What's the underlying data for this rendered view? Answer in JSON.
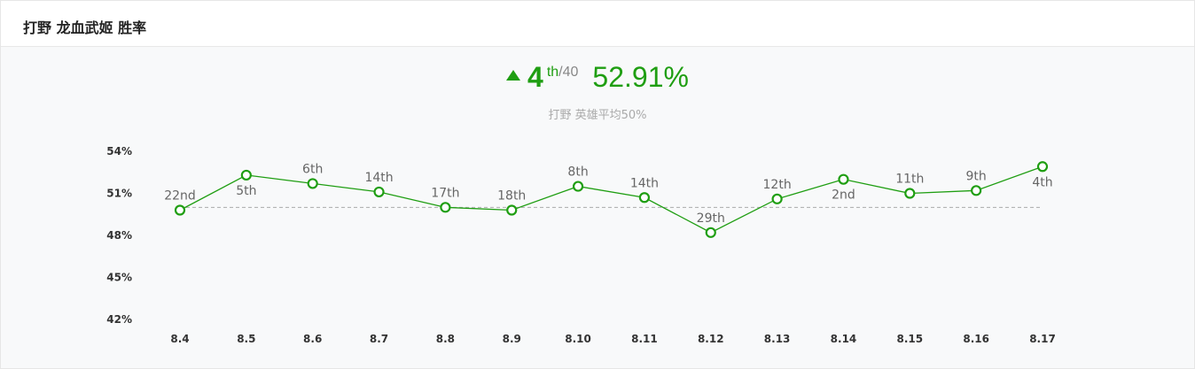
{
  "header": {
    "title": "打野 龙血武姬 胜率"
  },
  "summary": {
    "rank_icon": "triangle-up-icon",
    "rank": "4",
    "rank_suffix": "th",
    "rank_total": "/40",
    "winrate": "52.91%",
    "avg_note": "打野 英雄平均50%"
  },
  "colors": {
    "accent": "#1f9e12",
    "line": "#1f9e12",
    "reference_line": "#aaaaaa"
  },
  "chart_data": {
    "type": "line",
    "categories": [
      "8.4",
      "8.5",
      "8.6",
      "8.7",
      "8.8",
      "8.9",
      "8.10",
      "8.11",
      "8.12",
      "8.13",
      "8.14",
      "8.15",
      "8.16",
      "8.17"
    ],
    "values": [
      49.8,
      52.3,
      51.7,
      51.1,
      50.0,
      49.8,
      51.5,
      50.7,
      48.2,
      50.6,
      52.0,
      51.0,
      51.2,
      52.91
    ],
    "rank_labels": [
      "22nd",
      "5th",
      "6th",
      "14th",
      "17th",
      "18th",
      "8th",
      "14th",
      "29th",
      "12th",
      "2nd",
      "11th",
      "9th",
      "4th"
    ],
    "rank_label_position": [
      "above",
      "below",
      "above",
      "above",
      "above",
      "above",
      "above",
      "above",
      "above",
      "above",
      "below",
      "above",
      "above",
      "below"
    ],
    "yticks": [
      54,
      51,
      48,
      45,
      42
    ],
    "ytick_labels": [
      "54%",
      "51%",
      "48%",
      "45%",
      "42%"
    ],
    "ylim": [
      42,
      54
    ],
    "reference_line": 50,
    "grid": false,
    "legend": "none"
  }
}
